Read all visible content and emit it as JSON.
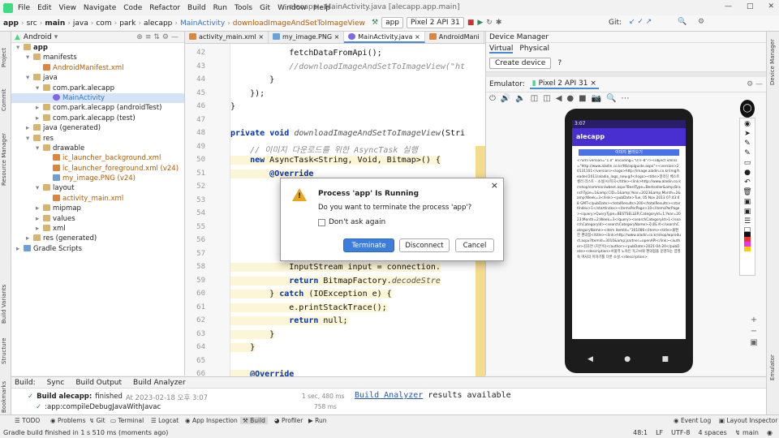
{
  "menu": {
    "items": [
      "File",
      "Edit",
      "View",
      "Navigate",
      "Code",
      "Refactor",
      "Build",
      "Run",
      "Tools",
      "Git",
      "Window",
      "Help"
    ],
    "window_title": "alecapp - MainActivity.java [alecapp.app.main]"
  },
  "breadcrumb": [
    "app",
    "src",
    "main",
    "java",
    "com",
    "park",
    "alecapp",
    "MainActivity",
    "downloadImageAndSetToImageView"
  ],
  "toolbar": {
    "run_config": "app",
    "device": "Pixel 2 API 31",
    "git_label": "Git:"
  },
  "left_tabs": [
    "Project",
    "Commit",
    "Resource Manager",
    "Build Variants",
    "Structure",
    "Bookmarks"
  ],
  "project": {
    "view": "Android",
    "tree": [
      {
        "label": "app",
        "indent": 0,
        "icon": "folder",
        "bold": true
      },
      {
        "label": "manifests",
        "indent": 1,
        "icon": "folder"
      },
      {
        "label": "AndroidManifest.xml",
        "indent": 2,
        "icon": "xml",
        "color": "#b35a00"
      },
      {
        "label": "java",
        "indent": 1,
        "icon": "folder"
      },
      {
        "label": "com.park.alecapp",
        "indent": 2,
        "icon": "folder"
      },
      {
        "label": "MainActivity",
        "indent": 3,
        "icon": "class",
        "sel": true,
        "color": "#3573cf"
      },
      {
        "label": "com.park.alecapp (androidTest)",
        "indent": 2,
        "icon": "folder"
      },
      {
        "label": "com.park.alecapp (test)",
        "indent": 2,
        "icon": "folder"
      },
      {
        "label": "java (generated)",
        "indent": 1,
        "icon": "folder"
      },
      {
        "label": "res",
        "indent": 1,
        "icon": "folder"
      },
      {
        "label": "drawable",
        "indent": 2,
        "icon": "folder"
      },
      {
        "label": "ic_launcher_background.xml",
        "indent": 3,
        "icon": "xml",
        "color": "#b35a00"
      },
      {
        "label": "ic_launcher_foreground.xml (v24)",
        "indent": 3,
        "icon": "xml",
        "color": "#b35a00"
      },
      {
        "label": "my_image.PNG (v24)",
        "indent": 3,
        "icon": "png",
        "color": "#b35a00"
      },
      {
        "label": "layout",
        "indent": 2,
        "icon": "folder"
      },
      {
        "label": "activity_main.xml",
        "indent": 3,
        "icon": "xml",
        "color": "#b35a00"
      },
      {
        "label": "mipmap",
        "indent": 2,
        "icon": "folder"
      },
      {
        "label": "values",
        "indent": 2,
        "icon": "folder"
      },
      {
        "label": "xml",
        "indent": 2,
        "icon": "folder"
      },
      {
        "label": "res (generated)",
        "indent": 1,
        "icon": "folder"
      },
      {
        "label": "Gradle Scripts",
        "indent": 0,
        "icon": "gradle"
      }
    ]
  },
  "editor_tabs": [
    "activity_main.xml",
    "my_image.PNG",
    "MainActivity.java",
    "AndroidMani"
  ],
  "code": {
    "lines": [
      {
        "n": "42",
        "html": "            fetchDataFromApi();"
      },
      {
        "n": "43",
        "html": "            //downloadImageAndSetToImageView(\"ht"
      },
      {
        "n": "44",
        "html": "        }"
      },
      {
        "n": "45",
        "html": "    });"
      },
      {
        "n": "46",
        "html": "}"
      },
      {
        "n": "47",
        "html": ""
      },
      {
        "n": "48",
        "html": "private void downloadImageAndSetToImageView(Stri"
      },
      {
        "n": "49",
        "html": "    // 이미지 다운로드를 위한 AsyncTask 실행"
      },
      {
        "n": "50",
        "html": "    new AsyncTask<String, Void, Bitmap>() {"
      },
      {
        "n": "51",
        "html": "        @Override"
      },
      {
        "n": "52",
        "html": ""
      },
      {
        "n": "53",
        "html": ""
      },
      {
        "n": "54",
        "html": ""
      },
      {
        "n": "55",
        "html": ""
      },
      {
        "n": "56",
        "html": ""
      },
      {
        "n": "57",
        "html": ""
      },
      {
        "n": "58",
        "html": "            InputStream input = connection."
      },
      {
        "n": "59",
        "html": "            return BitmapFactory.decodeStre"
      },
      {
        "n": "60",
        "html": "        } catch (IOException e) {"
      },
      {
        "n": "61",
        "html": "            e.printStackTrace();"
      },
      {
        "n": "62",
        "html": "            return null;"
      },
      {
        "n": "63",
        "html": "        }"
      },
      {
        "n": "64",
        "html": "    }"
      },
      {
        "n": "65",
        "html": ""
      },
      {
        "n": "66",
        "html": "    @Override"
      }
    ]
  },
  "dialog": {
    "title": "Process 'app' Is Running",
    "message": "Do you want to terminate the process 'app'?",
    "checkbox": "Don't ask again",
    "terminate": "Terminate",
    "disconnect": "Disconnect",
    "cancel": "Cancel"
  },
  "device_manager": {
    "title": "Device Manager",
    "tab_virtual": "Virtual",
    "tab_physical": "Physical",
    "create": "Create device",
    "help": "?"
  },
  "emulator": {
    "label": "Emulator:",
    "device": "Pixel 2 API 31",
    "time": "3:07",
    "app_title": "alecapp",
    "button": "이미지 불러오기",
    "response_text": "<?xml version=\"1.0\" encoding=\"UTF-8\"?><object xmlns=\"http://www.aladin.co.kr/ttb/apiguide.aspx\"><version>20131101</version><logo>http://image.aladin.co.kr/img/header/2011/aladin_logo_new.gif</logo><title>알라딘 베스트셀러 리스트 - 소설/시/희곡</title><link>http://www.aladin.co.kr/shop/common/wbest.aspx?BestType=Bestseller&amp;BranchType=1&amp;CID=1&amp;Year=2023&amp;Month=2&amp;Week=3</link><pubDate>Tue, 05 Nov 2013 07:43:48 GMT</pubDate><totalResults>200</totalResults><startIndex>1</startIndex><itemsPerPage>10</itemsPerPage><query>QueryType=BESTSELLER;CategoryId=1;Year=2023;Month=2;Week=3</query><searchCategoryId>1</searchCategoryId><searchCategoryName>국내도서</searchCategoryName><item itemId=\"301086</item><title>불편한 편의점</title><link>http://www.aladin.co.kr/shop/wproduct.aspx?ItemId=3010&amp;partner=openAPI</link><author>김호연 (지은이)</author><pubDate>2021-04-20</pubDate><description>서울역 노숙인 독고씨와 편의점을 운영하는 염영숙 여사의 이야기를 다룬 소설.</description>"
  },
  "build": {
    "tabs": [
      "Build:",
      "Sync",
      "Build Output",
      "Build Analyzer"
    ],
    "status": "Build alecapp:",
    "result": "finished",
    "time": "At 2023-02-18 오후 3:07",
    "task": ":app:compileDebugJavaWithJavac",
    "duration": "1 sec, 480 ms",
    "duration2": "758 ms",
    "analyzer_link": "Build Analyzer",
    "analyzer_text": " results available"
  },
  "bottom_tools": [
    "TODO",
    "Problems",
    "Git",
    "Terminal",
    "Logcat",
    "App Inspection",
    "Build",
    "Profiler",
    "Run"
  ],
  "right_bottom_tools": [
    "Event Log",
    "Layout Inspector"
  ],
  "status": {
    "message": "Gradle build finished in 1 s 510 ms (moments ago)",
    "position": "48:1",
    "line_sep": "LF",
    "encoding": "UTF-8",
    "indent": "4 spaces",
    "vcs": "main"
  }
}
